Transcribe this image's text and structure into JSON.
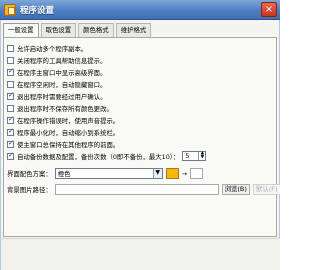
{
  "window": {
    "title": "程序设置",
    "app_icon": "settings-app-icon",
    "close_symbol": "×"
  },
  "tabs": [
    {
      "label": "一般设置",
      "active": true
    },
    {
      "label": "取色设置",
      "active": false
    },
    {
      "label": "颜色格式",
      "active": false
    },
    {
      "label": "维护格式",
      "active": false
    }
  ],
  "options": [
    {
      "label": "允许启动多个程序副本。",
      "checked": false
    },
    {
      "label": "关闭程序的工具帮助信息提示。",
      "checked": false
    },
    {
      "label": "在程序主窗口中显示高级界面。",
      "checked": true
    },
    {
      "label": "在程序空闲时，自动隐藏窗口。",
      "checked": false
    },
    {
      "label": "退出程序时需要经过用户确认。",
      "checked": true
    },
    {
      "label": "退出程序时不保存所有颜色更改。",
      "checked": false
    },
    {
      "label": "在程序操作错误时，使用声音提示。",
      "checked": true
    },
    {
      "label": "程序最小化时，自动缩小到系统栏。",
      "checked": true
    },
    {
      "label": "使主窗口总保持在其他程序的前面。",
      "checked": true
    },
    {
      "label": "自动备份数据及配置，备份次数（0即不备份，最大10）：",
      "checked": true
    }
  ],
  "backup": {
    "count": "5",
    "spin_up": "▲",
    "spin_down": "▼"
  },
  "color_scheme": {
    "label": "界面配色方案：",
    "value": "橙色",
    "dropdown_symbol": "▼",
    "arrow": "→",
    "selected_color": "#f7b900",
    "preview_color": "#ffffff"
  },
  "background_image": {
    "label": "背景图片路径：",
    "value": "",
    "browse_label": "浏览(B)",
    "default_label": "默认(F)"
  }
}
